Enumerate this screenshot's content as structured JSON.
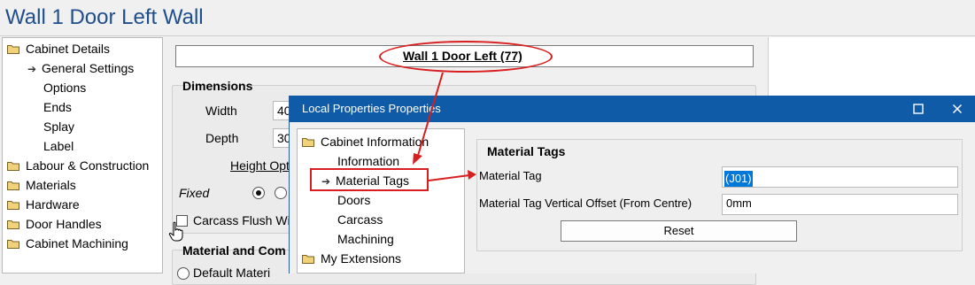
{
  "title": "Wall 1 Door Left Wall",
  "left_tree": {
    "items": [
      {
        "label": "Cabinet Details",
        "type": "folder"
      },
      {
        "label": "General Settings",
        "type": "arrow"
      },
      {
        "label": "Options",
        "type": "child"
      },
      {
        "label": "Ends",
        "type": "child"
      },
      {
        "label": "Splay",
        "type": "child"
      },
      {
        "label": "Label",
        "type": "child"
      },
      {
        "label": "Labour & Construction",
        "type": "folder"
      },
      {
        "label": "Materials",
        "type": "folder"
      },
      {
        "label": "Hardware",
        "type": "folder"
      },
      {
        "label": "Door Handles",
        "type": "folder"
      },
      {
        "label": "Cabinet Machining",
        "type": "folder"
      }
    ]
  },
  "main": {
    "header": "Wall 1 Door Left (77)",
    "dimensions": {
      "title": "Dimensions",
      "width_label": "Width",
      "width_value": "40",
      "depth_label": "Depth",
      "depth_value": "30",
      "height_options_link": "Height Optio",
      "fixed_label": "Fixed",
      "carcass_flush_label": "Carcass Flush With"
    },
    "material_group_title": "Material and Com",
    "default_material_label": "Default Materi"
  },
  "dialog": {
    "title": "Local Properties Properties",
    "maximize_icon": "maximize-icon",
    "close_icon": "close-icon",
    "tree": [
      {
        "label": "Cabinet Information",
        "type": "folder"
      },
      {
        "label": "Information",
        "type": "child"
      },
      {
        "label": "Material Tags",
        "type": "arrow"
      },
      {
        "label": "Doors",
        "type": "child"
      },
      {
        "label": "Carcass",
        "type": "child"
      },
      {
        "label": "Machining",
        "type": "child"
      },
      {
        "label": "My Extensions",
        "type": "folder"
      }
    ],
    "group_title": "Material Tags",
    "material_tag_label": "Material Tag",
    "material_tag_value": "(J01)",
    "offset_label": "Material Tag Vertical Offset (From Centre)",
    "offset_value": "0mm",
    "reset_label": "Reset"
  },
  "colors": {
    "title_blue": "#1f4e8c",
    "dialog_titlebar": "#0f5ba7",
    "annotation_red": "#d81e1e",
    "selection_blue": "#0078d7"
  }
}
